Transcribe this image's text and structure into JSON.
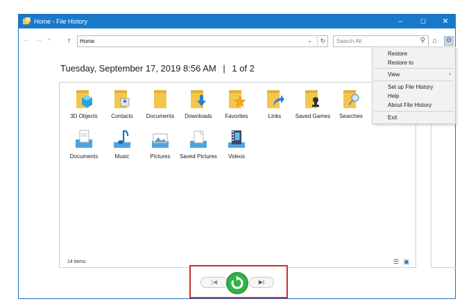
{
  "window": {
    "title": "Home - File History",
    "minimize": "–",
    "maximize": "☐",
    "close": "✕"
  },
  "toolbar": {
    "back": "←",
    "forward": "→",
    "recent": "⌄",
    "up": "↑",
    "address_value": "Home",
    "dropdown": "⌄",
    "refresh": "↻",
    "search_placeholder": "Search All",
    "search_icon": "⚲",
    "home_icon": "⌂",
    "gear_icon": "⚙"
  },
  "heading": {
    "date": "Tuesday, September 17, 2019 8:56 AM",
    "separator": "|",
    "page": "1 of 2"
  },
  "items": [
    {
      "label": "3D Objects",
      "icon": "folder-3d-objects-icon"
    },
    {
      "label": "Contacts",
      "icon": "folder-contacts-icon"
    },
    {
      "label": "Documents",
      "icon": "folder-documents-icon"
    },
    {
      "label": "Downloads",
      "icon": "folder-downloads-icon"
    },
    {
      "label": "Favorites",
      "icon": "folder-favorites-icon"
    },
    {
      "label": "Links",
      "icon": "folder-links-icon"
    },
    {
      "label": "Saved Games",
      "icon": "folder-saved-games-icon"
    },
    {
      "label": "Searches",
      "icon": "folder-searches-icon"
    },
    {
      "label": "Documents",
      "icon": "library-documents-icon"
    },
    {
      "label": "Music",
      "icon": "library-music-icon"
    },
    {
      "label": "Pictures",
      "icon": "library-pictures-icon"
    },
    {
      "label": "Saved Pictures",
      "icon": "library-saved-pictures-icon"
    },
    {
      "label": "Videos",
      "icon": "library-videos-icon"
    }
  ],
  "status": {
    "item_count": "14 items",
    "details_view": "☰",
    "large_icons_view": "▣"
  },
  "menu": {
    "restore": "Restore",
    "restore_to": "Restore to",
    "view": "View",
    "view_arrow": "›",
    "setup": "Set up File History",
    "help": "Help",
    "about": "About File History",
    "exit": "Exit"
  },
  "nav": {
    "previous": "|◀",
    "next": "▶|"
  },
  "colors": {
    "titlebar": "#1979ca",
    "folder": "#f3c74d",
    "restore_green": "#34b24a",
    "highlight_red": "#d22b2b"
  }
}
